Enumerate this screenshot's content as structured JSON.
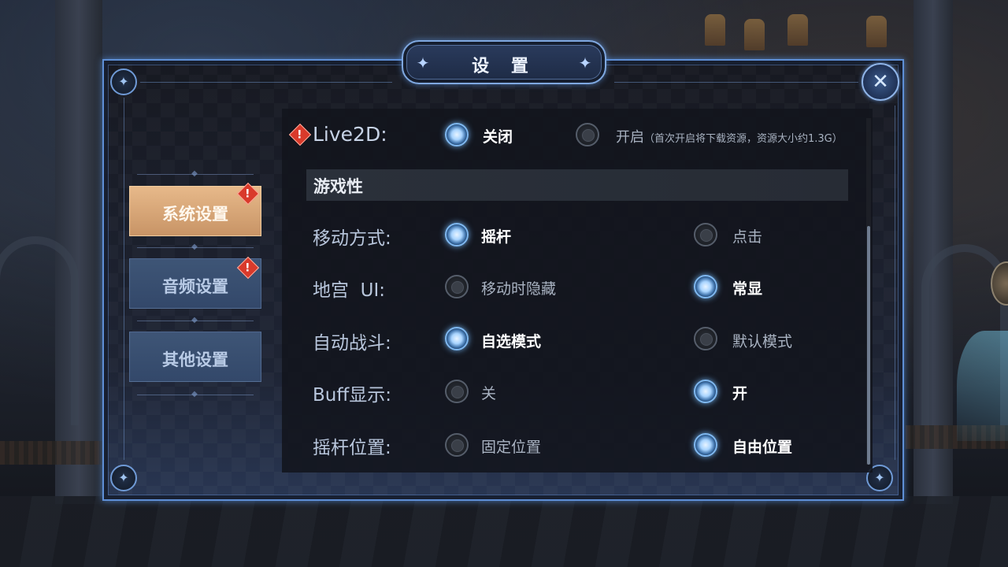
{
  "title": "设 置",
  "tabs": [
    {
      "label": "系统设置",
      "active": true,
      "alert": true
    },
    {
      "label": "音频设置",
      "active": false,
      "alert": true
    },
    {
      "label": "其他设置",
      "active": false,
      "alert": false
    }
  ],
  "alert_mark": "!",
  "close_icon": "✕",
  "live2d": {
    "label": "Live2D:",
    "option_off": "关闭",
    "option_on": "开启",
    "option_on_note": "（首次开启将下载资源，资源大小约1.3G）",
    "selected": "off"
  },
  "section_title": "游戏性",
  "settings": [
    {
      "label": "移动方式:",
      "left": "摇杆",
      "right": "点击",
      "selected": "left"
    },
    {
      "label": "地宫  UI:",
      "left": "移动时隐藏",
      "right": "常显",
      "selected": "right"
    },
    {
      "label": "自动战斗:",
      "left": "自选模式",
      "right": "默认模式",
      "selected": "left"
    },
    {
      "label": "Buff显示:",
      "left": "关",
      "right": "开",
      "selected": "right"
    },
    {
      "label": "摇杆位置:",
      "left": "固定位置",
      "right": "自由位置",
      "selected": "right"
    }
  ],
  "colors": {
    "panel_border": "#5e8fd6",
    "active_tab": "#d8a878",
    "inactive_tab": "#3a5070",
    "alert": "#d93a2b",
    "radio_on_glow": "#7fb8f0"
  }
}
